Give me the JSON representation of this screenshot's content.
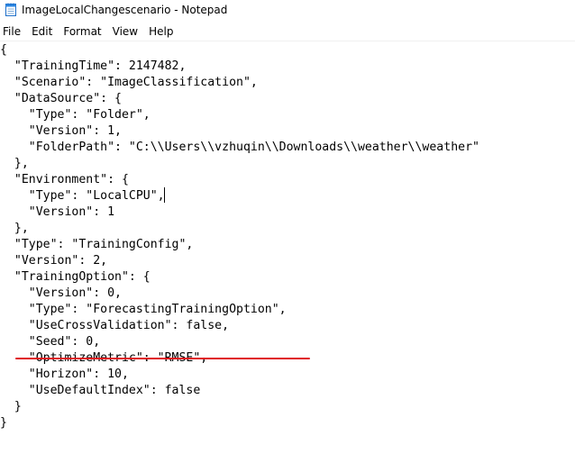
{
  "window": {
    "title": "ImageLocalChangescenario - Notepad",
    "app_icon": "notepad-icon"
  },
  "menubar": {
    "items": [
      "File",
      "Edit",
      "Format",
      "View",
      "Help"
    ]
  },
  "editor": {
    "lines": [
      "{",
      "  \"TrainingTime\": 2147482,",
      "  \"Scenario\": \"ImageClassification\",",
      "  \"DataSource\": {",
      "    \"Type\": \"Folder\",",
      "    \"Version\": 1,",
      "    \"FolderPath\": \"C:\\\\Users\\\\vzhuqin\\\\Downloads\\\\weather\\\\weather\"",
      "  },",
      "  \"Environment\": {",
      "    \"Type\": \"LocalCPU\",",
      "    \"Version\": 1",
      "  },",
      "  \"Type\": \"TrainingConfig\",",
      "  \"Version\": 2,",
      "  \"TrainingOption\": {",
      "    \"Version\": 0,",
      "    \"Type\": \"ForecastingTrainingOption\",",
      "    \"UseCrossValidation\": false,",
      "    \"Seed\": 0,",
      "    \"OptimizeMetric\": \"RMSE\",",
      "    \"Horizon\": 10,",
      "    \"UseDefaultIndex\": false",
      "  }",
      "}"
    ],
    "annotation_color": "#e0161c"
  }
}
